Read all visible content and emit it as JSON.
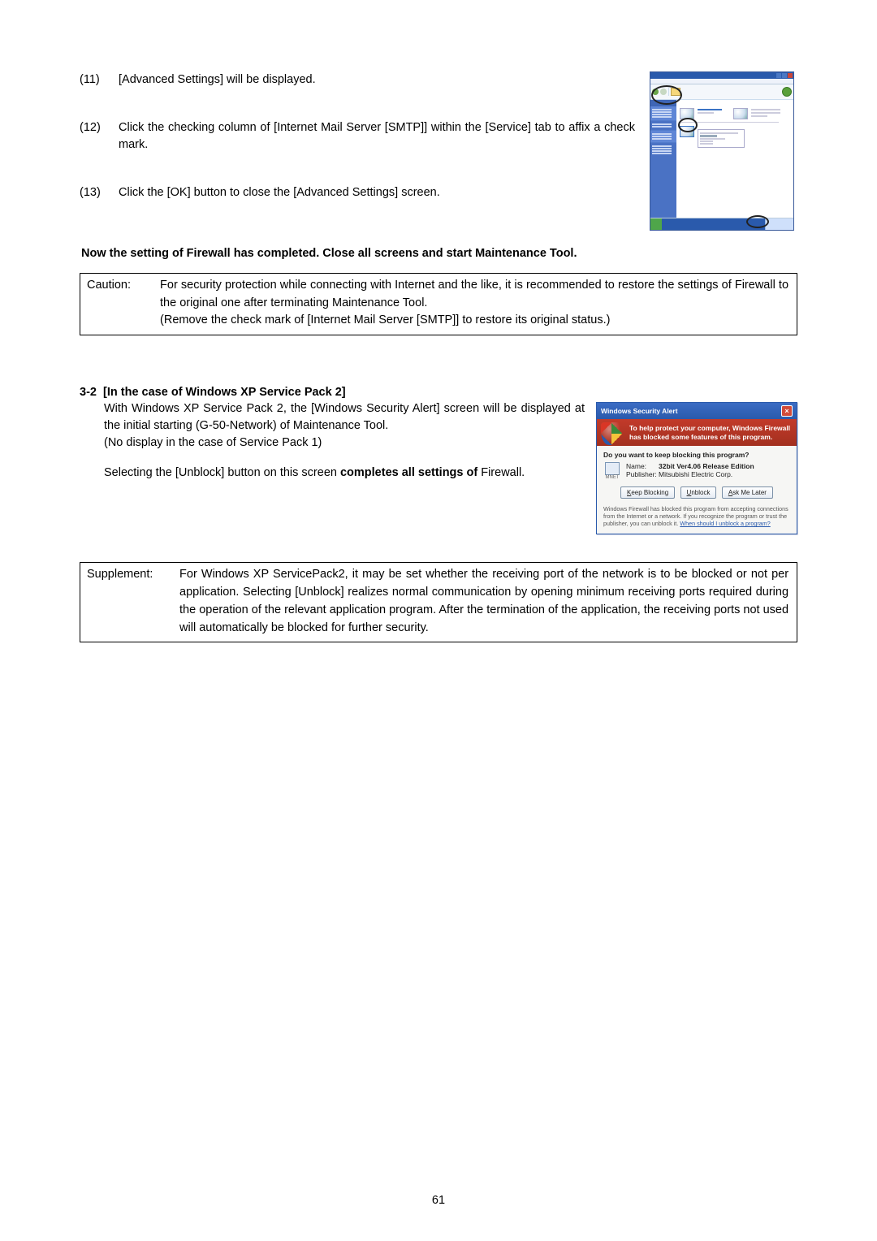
{
  "steps": [
    {
      "num": "(11)",
      "text": "[Advanced Settings] will be displayed."
    },
    {
      "num": "(12)",
      "text": "Click the checking column of [Internet Mail Server [SMTP]] within the [Service] tab to affix a check mark."
    },
    {
      "num": "(13)",
      "text": "Click the [OK] button to close the [Advanced Settings] screen."
    }
  ],
  "completed_line": "Now the setting of Firewall has completed.    Close all screens and start Maintenance Tool.",
  "caution": {
    "label": "Caution:",
    "body": "For security protection while connecting with Internet and the like, it is recommended to restore the settings of Firewall to the original one after terminating Maintenance Tool.\n(Remove the check mark of [Internet Mail Server [SMTP]] to restore its original status.)"
  },
  "section": {
    "head_prefix": "3-2",
    "head_title": "[In the case of Windows XP Service Pack 2]",
    "p1": "With Windows XP Service Pack 2, the [Windows Security Alert] screen will be displayed at the initial starting (G-50-Network) of Maintenance Tool.",
    "p1b": "(No display in the case of Service Pack 1)",
    "p2_pre": "Selecting the [Unblock] button on this screen ",
    "p2_bold": "completes all settings of",
    "p2_post": " Firewall."
  },
  "alert": {
    "title": "Windows Security Alert",
    "banner": "To help protect your computer, Windows Firewall has blocked some features of this program.",
    "question": "Do you want to keep blocking this program?",
    "app_icon_label": "MNET",
    "name_k": "Name:",
    "name_v": "32bit Ver4.06 Release Edition",
    "pub_k": "Publisher:",
    "pub_v": "Mitsubishi Electric Corp.",
    "btn_keep": "Keep Blocking",
    "btn_unblock": "Unblock",
    "btn_ask": "Ask Me Later",
    "footer_text": "Windows Firewall has blocked this program from accepting connections from the Internet or a network. If you recognize the program or trust the publisher, you can unblock it. ",
    "footer_link": "When should I unblock a program?"
  },
  "supplement": {
    "label": "Supplement:",
    "body": "For Windows XP ServicePack2, it may be set whether the receiving port of the network is to be blocked or not per application. Selecting [Unblock] realizes normal communication by opening minimum receiving ports required during the operation of the relevant application program.  After the termination of the application, the receiving ports not used will automatically be blocked for further security."
  },
  "page_number": "61"
}
